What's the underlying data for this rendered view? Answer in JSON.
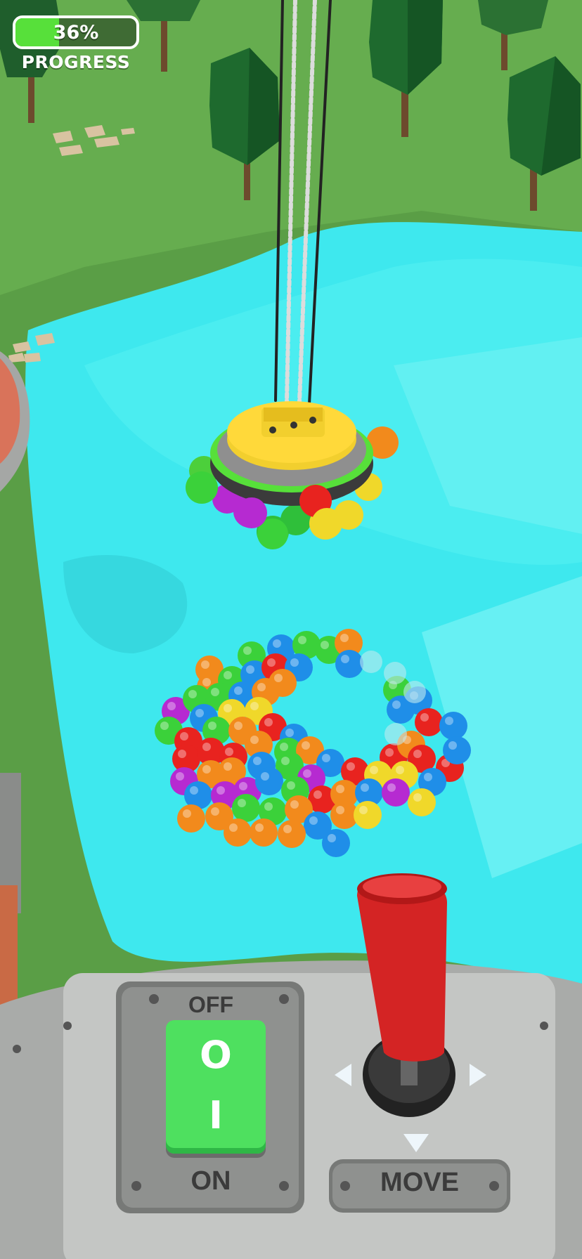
{
  "hud": {
    "progress_percent": 36,
    "progress_text": "36%",
    "progress_label": "PROGRESS"
  },
  "control_panel": {
    "switch_off_label": "OFF",
    "switch_on_label": "ON",
    "switch_top_symbol": "O",
    "switch_bottom_symbol": "I",
    "move_label": "MOVE"
  },
  "colors": {
    "progress_fill": "#57e03a",
    "water": "#3ee8ee",
    "grass": "#5a9e46",
    "switch_green": "#4ee05f",
    "joystick_red": "#d42424",
    "magnet_yellow": "#f2cf2e"
  },
  "icons": {
    "left_arrow": "triangle-left-icon",
    "right_arrow": "triangle-right-icon",
    "down_arrow": "triangle-down-icon"
  }
}
